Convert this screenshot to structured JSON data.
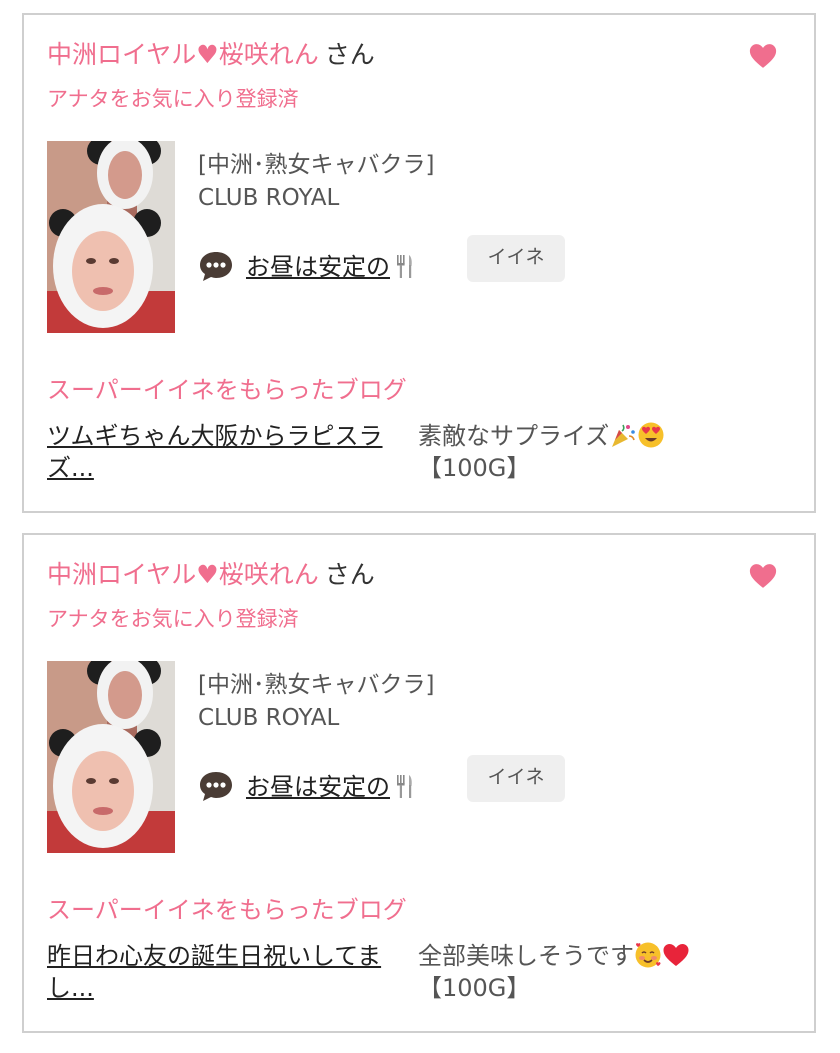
{
  "cards": [
    {
      "cast_name": "中洲ロイヤル",
      "cast_name_2": "桜咲れん",
      "suffix": "さん",
      "registered_text": "アナタをお気に入り登録済",
      "shop_category": "[中洲･熟女キャバクラ]",
      "shop_name": "CLUB ROYAL",
      "comment_text": "お昼は安定の",
      "iine_label": "イイネ",
      "super_title": "スーパーイイネをもらったブログ",
      "blog_title": "ツムギちゃん大阪からラピスラズ...",
      "blog_comment": "素敵なサプライズ",
      "reward": "【100G】",
      "emojis": [
        "party-popper",
        "heart-eyes"
      ]
    },
    {
      "cast_name": "中洲ロイヤル",
      "cast_name_2": "桜咲れん",
      "suffix": "さん",
      "registered_text": "アナタをお気に入り登録済",
      "shop_category": "[中洲･熟女キャバクラ]",
      "shop_name": "CLUB ROYAL",
      "comment_text": "お昼は安定の",
      "iine_label": "イイネ",
      "super_title": "スーパーイイネをもらったブログ",
      "blog_title": "昨日わ心友の誕生日祝いしてまし...",
      "blog_comment": "全部美味しそうです",
      "reward": "【100G】",
      "emojis": [
        "smiling-hearts",
        "red-heart"
      ]
    }
  ],
  "colors": {
    "accent_pink": "#f06e8e",
    "text_dark": "#222222",
    "text_gray": "#555555",
    "button_bg": "#efefef",
    "border": "#cfcfcf"
  },
  "icons": [
    "favorite-heart-icon",
    "comment-bubble-icon",
    "fork-knife-icon"
  ]
}
